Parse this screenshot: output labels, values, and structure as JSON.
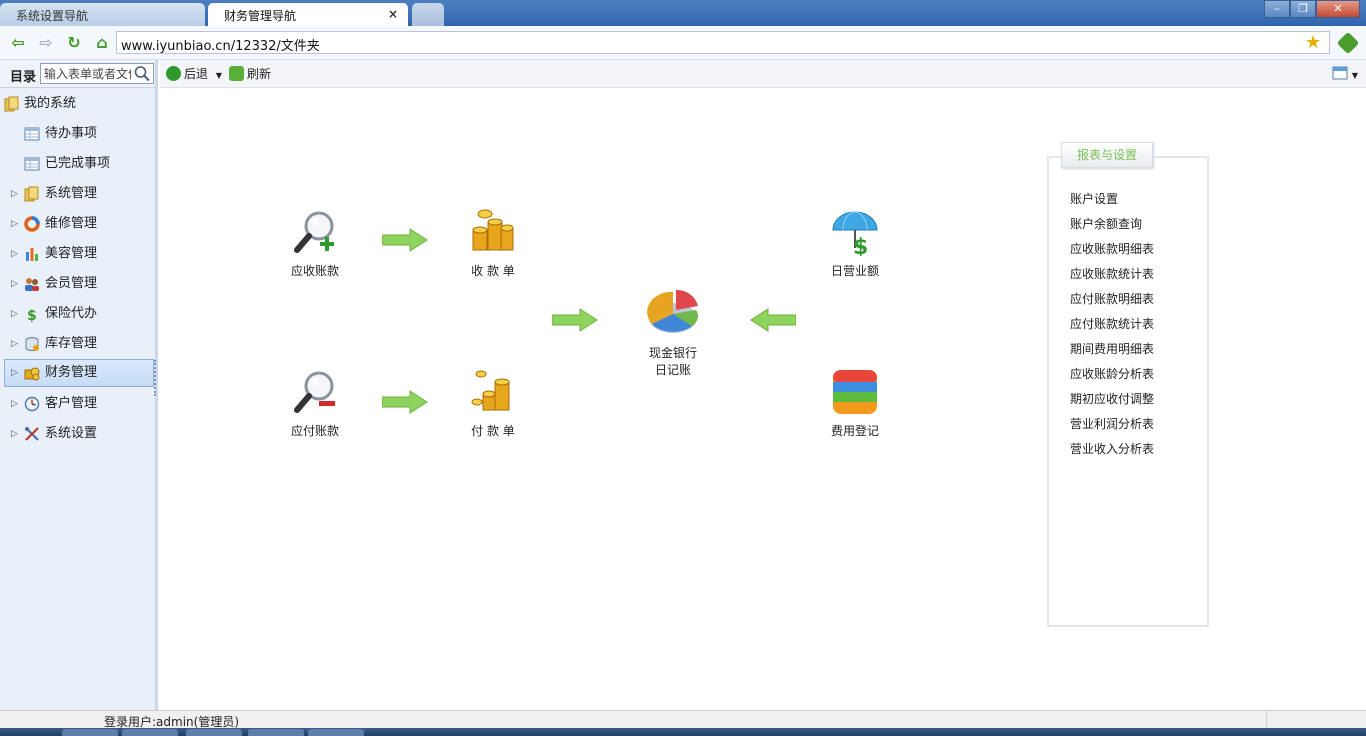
{
  "browser": {
    "tabs": [
      {
        "label": "系统设置导航",
        "active": false
      },
      {
        "label": "财务管理导航",
        "active": true
      }
    ],
    "tab_close": "×",
    "address": "www.iyunbiao.cn/12332/文件夹",
    "window_buttons": {
      "minimize": "–",
      "restore": "❐",
      "close": "✕"
    }
  },
  "sidebar": {
    "title": "目录",
    "search_placeholder": "输入表单或者文件",
    "root": "我的系统",
    "items": [
      {
        "label": "待办事项",
        "icon": "table-icon",
        "expandable": false
      },
      {
        "label": "已完成事项",
        "icon": "table-icon",
        "expandable": false
      },
      {
        "label": "系统管理",
        "icon": "folder-icon",
        "expandable": true
      },
      {
        "label": "维修管理",
        "icon": "ring-icon",
        "expandable": true
      },
      {
        "label": "美容管理",
        "icon": "bar-chart-icon",
        "expandable": true
      },
      {
        "label": "会员管理",
        "icon": "people-icon",
        "expandable": true
      },
      {
        "label": "保险代办",
        "icon": "dollar-icon",
        "expandable": true
      },
      {
        "label": "库存管理",
        "icon": "database-icon",
        "expandable": true
      },
      {
        "label": "财务管理",
        "icon": "coins-icon",
        "expandable": true,
        "selected": true
      },
      {
        "label": "客户管理",
        "icon": "clock-icon",
        "expandable": true
      },
      {
        "label": "系统设置",
        "icon": "tools-icon",
        "expandable": true
      }
    ]
  },
  "toolbar": {
    "back": "后退",
    "refresh": "刷新"
  },
  "flow": {
    "receivable": "应收账款",
    "receipt": "收 款 单",
    "payable": "应付账款",
    "payment": "付 款 单",
    "cash_journal_line1": "现金银行",
    "cash_journal_line2": "日记账",
    "daily_revenue": "日营业额",
    "expense_register": "费用登记"
  },
  "panel": {
    "title": "报表与设置",
    "links": [
      "账户设置",
      "账户余额查询",
      "应收账款明细表",
      "应收账款统计表",
      "应付账款明细表",
      "应付账款统计表",
      "期间费用明细表",
      "应收账龄分析表",
      "期初应收付调整",
      "营业利润分析表",
      "营业收入分析表"
    ]
  },
  "status": {
    "user": "登录用户:admin(管理员)"
  },
  "colors": {
    "accent_green": "#7cc05a",
    "arrow_green": "#8fd35f",
    "sidebar_bg": "#e9f0f9"
  }
}
